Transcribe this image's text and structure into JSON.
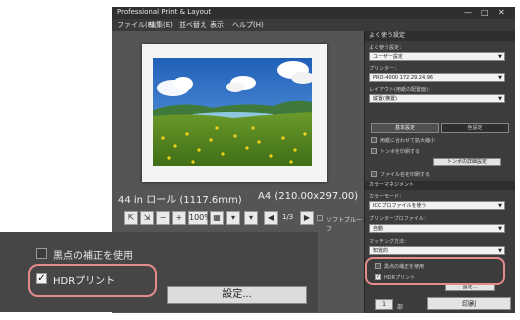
{
  "window": {
    "title": "Professional Print & Layout",
    "controls": {
      "minimize": "—",
      "maximize": "□",
      "close": "✕"
    }
  },
  "menu": [
    "ファイル(F)",
    "編集(E)",
    "並べ替え",
    "表示",
    "ヘルプ(H)"
  ],
  "preview": {
    "left_caption": "44 in ロール (1117.6mm)",
    "right_caption": "A4 (210.00x297.00)"
  },
  "toolbar": {
    "zoom_value": "100%",
    "page_indicator": "1/3",
    "softproof_label": "ソフトプルーフ"
  },
  "panel": {
    "header": "よく使う設定",
    "user_settings_label": "よく使う設定：",
    "user_settings_value": "ユーザー設定",
    "printer_label": "プリンター：",
    "printer_value": "PRO-4000 172.29.24.96",
    "layout_label": "レイアウト(用紙の配置面)：",
    "layout_value": "縦置(横置)",
    "tab_basic": "基本設定",
    "tab_color": "色設定",
    "check_mirror": "用紙に合わせて拡大縮小",
    "check_trim": "トンボを印刷する",
    "trim_button": "トンボの詳細設定",
    "check_filename": "ファイル名を印刷する",
    "color_mgmt_header": "カラーマネジメント",
    "color_mode_label": "カラーモード：",
    "color_mode_value": "ICCプロファイルを使う",
    "printer_profile_label": "プリンタープロファイル：",
    "printer_profile_value": "自動",
    "matching_label": "マッチング方法：",
    "matching_value": "知覚的",
    "check_black_small": "黒点の補正を使用",
    "check_hdr_small": "HDRプリント",
    "settings_small": "設定...",
    "copies_value": "1",
    "copies_unit": "部",
    "print_button": "印刷"
  },
  "zoomed": {
    "black_point": "黒点の補正を使用",
    "hdr_print": "HDRプリント",
    "settings_button": "設定..."
  },
  "colors": {
    "highlight": "#e58b8b",
    "app_bg": "#4a4a4a",
    "panel_bg": "#3c3c3c"
  }
}
